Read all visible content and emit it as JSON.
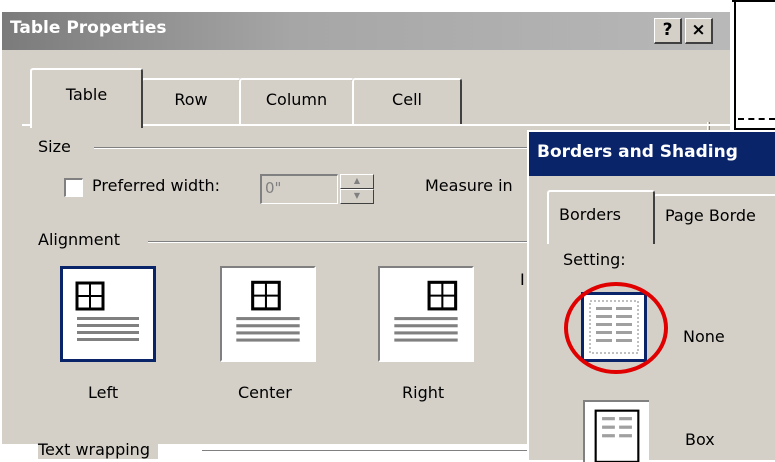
{
  "table_properties": {
    "title": "Table Properties",
    "help_btn": "?",
    "close_btn": "×",
    "tabs": [
      {
        "label": "Table",
        "active": true
      },
      {
        "label": "Row",
        "active": false
      },
      {
        "label": "Column",
        "active": false
      },
      {
        "label": "Cell",
        "active": false
      }
    ],
    "size": {
      "group_label": "Size",
      "preferred_width_label": "Preferred width:",
      "preferred_width_checked": false,
      "preferred_width_value": "0\"",
      "measure_in_label": "Measure in"
    },
    "alignment": {
      "group_label": "Alignment",
      "options": [
        "Left",
        "Center",
        "Right"
      ],
      "selected": "Left",
      "cut_off_text": "I"
    },
    "text_wrapping": {
      "group_label": "Text wrapping"
    }
  },
  "borders_and_shading": {
    "title": "Borders and Shading",
    "tabs": [
      {
        "label": "Borders",
        "active": true
      },
      {
        "label": "Page Borde",
        "active": false
      }
    ],
    "setting_label": "Setting:",
    "settings": [
      {
        "label": "None",
        "selected": true,
        "highlighted": true
      },
      {
        "label": "Box",
        "selected": false
      }
    ],
    "highlight_color": "#e00000"
  },
  "colors": {
    "dialog_face": "#d4d0c8",
    "active_title": "#0a246a",
    "selection_border": "#0a246a"
  }
}
